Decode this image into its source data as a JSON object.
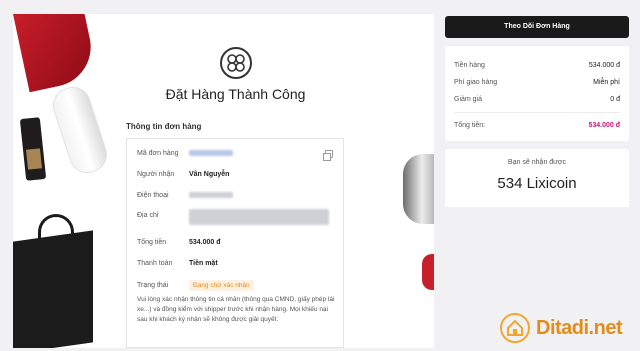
{
  "main": {
    "title": "Đặt Hàng Thành Công",
    "section_title": "Thông tin đơn hàng",
    "rows": [
      {
        "label": "Mã đơn hàng",
        "value": ""
      },
      {
        "label": "Người nhận",
        "value": "Vân Nguyễn"
      },
      {
        "label": "Điện thoại",
        "value": ""
      },
      {
        "label": "Địa chỉ",
        "value": ""
      },
      {
        "label": "Tổng tiền",
        "value": "534.000 đ"
      },
      {
        "label": "Thanh toán",
        "value": "Tiền mặt"
      },
      {
        "label": "Trạng thái",
        "value": "Đang chờ xác nhận"
      }
    ],
    "note": "Vui lòng xác nhận thông tin cá nhân (thông qua CMND, giấy phép lái xe...) và đồng kiểm với shipper trước khi nhận hàng. Mọi khiếu nại sau khi khách ký nhận sẽ không được giải quyết."
  },
  "sidebar": {
    "track_button": "Theo Dõi Đơn Hàng",
    "summary": [
      {
        "label": "Tiền hàng",
        "value": "534.000 đ"
      },
      {
        "label": "Phí giao hàng",
        "value": "Miễn phí"
      },
      {
        "label": "Giảm giá",
        "value": "0 đ"
      }
    ],
    "total_label": "Tổng tiền:",
    "total_value": "534.000 đ",
    "points_label": "Bạn sẽ nhận được",
    "points_value": "534 Lixicoin"
  },
  "watermark": {
    "text": "Ditadi.net"
  },
  "colors": {
    "accent": "#c8157a",
    "status": "#e0871f",
    "button_bg": "#1a1a1a"
  },
  "icons": [
    "logo-icon",
    "copy-icon",
    "house-icon"
  ]
}
